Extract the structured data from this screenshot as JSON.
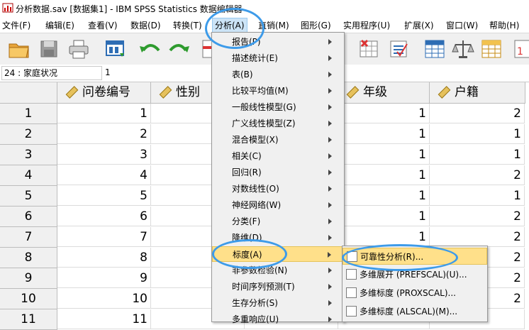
{
  "window": {
    "title": "分析数据.sav [数据集1] - IBM SPSS Statistics 数据编辑器"
  },
  "menubar": {
    "items": [
      "文件(F)",
      "编辑(E)",
      "查看(V)",
      "数据(D)",
      "转换(T)",
      "分析(A)",
      "直销(M)",
      "图形(G)",
      "实用程序(U)",
      "扩展(X)",
      "窗口(W)",
      "帮助(H)"
    ],
    "active": "分析(A)"
  },
  "toolbar": {
    "buttons": [
      "open-folder-icon",
      "save-icon",
      "print-icon",
      "recall-dialog-icon",
      "undo-icon",
      "redo-icon",
      "goto-case-icon",
      "goto-variable-icon",
      "variables-icon",
      "insert-cases-icon",
      "split-file-icon",
      "select-cases-icon",
      "weight-cases-icon",
      "value-labels-icon"
    ]
  },
  "refbar": {
    "cell_name": "24 : 家庭状况",
    "cell_value": "1"
  },
  "grid": {
    "columns": [
      "问卷编号",
      "性别",
      "",
      "年级",
      "户籍"
    ],
    "rows": [
      {
        "row": "1",
        "values": [
          "1",
          "",
          "",
          "1",
          "2"
        ]
      },
      {
        "row": "2",
        "values": [
          "2",
          "",
          "",
          "1",
          "1"
        ]
      },
      {
        "row": "3",
        "values": [
          "3",
          "",
          "",
          "1",
          "1"
        ]
      },
      {
        "row": "4",
        "values": [
          "4",
          "",
          "",
          "1",
          "2"
        ]
      },
      {
        "row": "5",
        "values": [
          "5",
          "",
          "",
          "1",
          "1"
        ]
      },
      {
        "row": "6",
        "values": [
          "6",
          "",
          "",
          "1",
          "2"
        ]
      },
      {
        "row": "7",
        "values": [
          "7",
          "",
          "",
          "1",
          "2"
        ]
      },
      {
        "row": "8",
        "values": [
          "8",
          "",
          "",
          "",
          "2"
        ]
      },
      {
        "row": "9",
        "values": [
          "9",
          "",
          "",
          "",
          "2"
        ]
      },
      {
        "row": "10",
        "values": [
          "10",
          "",
          "",
          "",
          "2"
        ]
      },
      {
        "row": "11",
        "values": [
          "11",
          "",
          "",
          "",
          ""
        ]
      }
    ]
  },
  "analyze_menu": {
    "items": [
      "报告(P)",
      "描述统计(E)",
      "表(B)",
      "比较平均值(M)",
      "一般线性模型(G)",
      "广义线性模型(Z)",
      "混合模型(X)",
      "相关(C)",
      "回归(R)",
      "对数线性(O)",
      "神经网络(W)",
      "分类(F)",
      "降维(D)",
      "标度(A)",
      "非参数检验(N)",
      "时间序列预测(T)",
      "生存分析(S)",
      "多重响应(U)"
    ],
    "highlighted": "标度(A)"
  },
  "scale_submenu": {
    "items": [
      "可靠性分析(R)...",
      "多维展开 (PREFSCAL)(U)...",
      "多维标度 (PROXSCAL)...",
      "多维标度 (ALSCAL)(M)..."
    ],
    "highlighted": "可靠性分析(R)..."
  },
  "colors": {
    "highlight": "#ffe08a",
    "annotation": "#3d9be9",
    "menu_bg": "#f0f0f0"
  }
}
